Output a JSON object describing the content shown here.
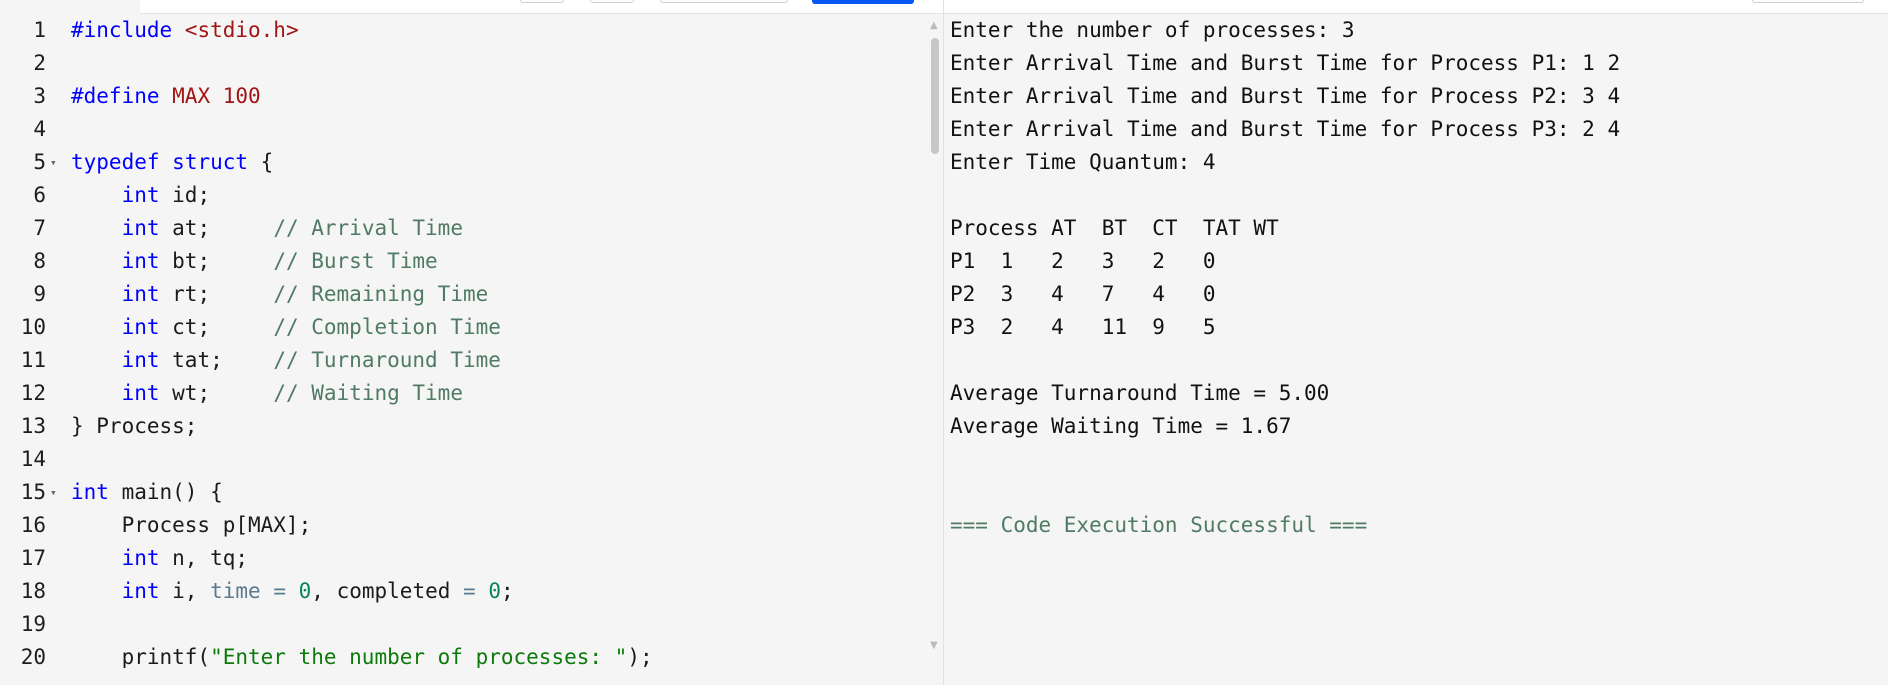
{
  "editor": {
    "lines": [
      {
        "n": "1",
        "fold": "",
        "tokens": [
          [
            "hash",
            "#include "
          ],
          [
            "str",
            "<stdio.h>"
          ]
        ]
      },
      {
        "n": "2",
        "fold": "",
        "tokens": []
      },
      {
        "n": "3",
        "fold": "",
        "tokens": [
          [
            "hash",
            "#define "
          ],
          [
            "def",
            "MAX 100"
          ]
        ]
      },
      {
        "n": "4",
        "fold": "",
        "tokens": []
      },
      {
        "n": "5",
        "fold": "▾",
        "tokens": [
          [
            "kw",
            "typedef"
          ],
          [
            "call",
            " "
          ],
          [
            "kw",
            "struct"
          ],
          [
            "call",
            " {"
          ]
        ]
      },
      {
        "n": "6",
        "fold": "",
        "tokens": [
          [
            "call",
            "    "
          ],
          [
            "kt",
            "int"
          ],
          [
            "call",
            " id;"
          ]
        ]
      },
      {
        "n": "7",
        "fold": "",
        "tokens": [
          [
            "call",
            "    "
          ],
          [
            "kt",
            "int"
          ],
          [
            "call",
            " at;     "
          ],
          [
            "com",
            "// Arrival Time"
          ]
        ]
      },
      {
        "n": "8",
        "fold": "",
        "tokens": [
          [
            "call",
            "    "
          ],
          [
            "kt",
            "int"
          ],
          [
            "call",
            " bt;     "
          ],
          [
            "com",
            "// Burst Time"
          ]
        ]
      },
      {
        "n": "9",
        "fold": "",
        "tokens": [
          [
            "call",
            "    "
          ],
          [
            "kt",
            "int"
          ],
          [
            "call",
            " rt;     "
          ],
          [
            "com",
            "// Remaining Time"
          ]
        ]
      },
      {
        "n": "10",
        "fold": "",
        "tokens": [
          [
            "call",
            "    "
          ],
          [
            "kt",
            "int"
          ],
          [
            "call",
            " ct;     "
          ],
          [
            "com",
            "// Completion Time"
          ]
        ]
      },
      {
        "n": "11",
        "fold": "",
        "tokens": [
          [
            "call",
            "    "
          ],
          [
            "kt",
            "int"
          ],
          [
            "call",
            " tat;    "
          ],
          [
            "com",
            "// Turnaround Time"
          ]
        ]
      },
      {
        "n": "12",
        "fold": "",
        "tokens": [
          [
            "call",
            "    "
          ],
          [
            "kt",
            "int"
          ],
          [
            "call",
            " wt;     "
          ],
          [
            "com",
            "// Waiting Time"
          ]
        ]
      },
      {
        "n": "13",
        "fold": "",
        "tokens": [
          [
            "call",
            "} Process;"
          ]
        ]
      },
      {
        "n": "14",
        "fold": "",
        "tokens": []
      },
      {
        "n": "15",
        "fold": "▾",
        "tokens": [
          [
            "kt",
            "int"
          ],
          [
            "call",
            " main() {"
          ]
        ]
      },
      {
        "n": "16",
        "fold": "",
        "tokens": [
          [
            "call",
            "    Process p[MAX];"
          ]
        ]
      },
      {
        "n": "17",
        "fold": "",
        "tokens": [
          [
            "call",
            "    "
          ],
          [
            "kt",
            "int"
          ],
          [
            "call",
            " n, tq;"
          ]
        ]
      },
      {
        "n": "18",
        "fold": "",
        "tokens": [
          [
            "call",
            "    "
          ],
          [
            "kt",
            "int"
          ],
          [
            "call",
            " i, "
          ],
          [
            "op",
            "time"
          ],
          [
            "call",
            " "
          ],
          [
            "op",
            "="
          ],
          [
            "call",
            " "
          ],
          [
            "num",
            "0"
          ],
          [
            "call",
            ", completed "
          ],
          [
            "op",
            "="
          ],
          [
            "call",
            " "
          ],
          [
            "num",
            "0"
          ],
          [
            "call",
            ";"
          ]
        ]
      },
      {
        "n": "19",
        "fold": "",
        "tokens": []
      },
      {
        "n": "20",
        "fold": "",
        "tokens": [
          [
            "call",
            "    printf("
          ],
          [
            "strg",
            "\"Enter the number of processes: \""
          ],
          [
            "call",
            ");"
          ]
        ]
      }
    ]
  },
  "output": {
    "lines": [
      {
        "text": "Enter the number of processes: 3",
        "style": ""
      },
      {
        "text": "Enter Arrival Time and Burst Time for Process P1: 1 2",
        "style": ""
      },
      {
        "text": "Enter Arrival Time and Burst Time for Process P2: 3 4",
        "style": ""
      },
      {
        "text": "Enter Arrival Time and Burst Time for Process P3: 2 4",
        "style": ""
      },
      {
        "text": "Enter Time Quantum: 4",
        "style": ""
      },
      {
        "text": "",
        "style": ""
      },
      {
        "text": "Process AT  BT  CT  TAT WT",
        "style": ""
      },
      {
        "text": "P1  1   2   3   2   0",
        "style": ""
      },
      {
        "text": "P2  3   4   7   4   0",
        "style": ""
      },
      {
        "text": "P3  2   4   11  9   5",
        "style": ""
      },
      {
        "text": "",
        "style": ""
      },
      {
        "text": "Average Turnaround Time = 5.00",
        "style": ""
      },
      {
        "text": "Average Waiting Time = 1.67",
        "style": ""
      },
      {
        "text": "",
        "style": ""
      },
      {
        "text": "",
        "style": ""
      },
      {
        "text": "=== Code Execution Successful ===",
        "style": "success"
      }
    ]
  },
  "colors": {
    "run_button": "#0556f3",
    "keyword": "#0000ff",
    "string_include": "#a31515",
    "comment": "#4f7a63",
    "number": "#098658",
    "success": "#4f7a63"
  }
}
